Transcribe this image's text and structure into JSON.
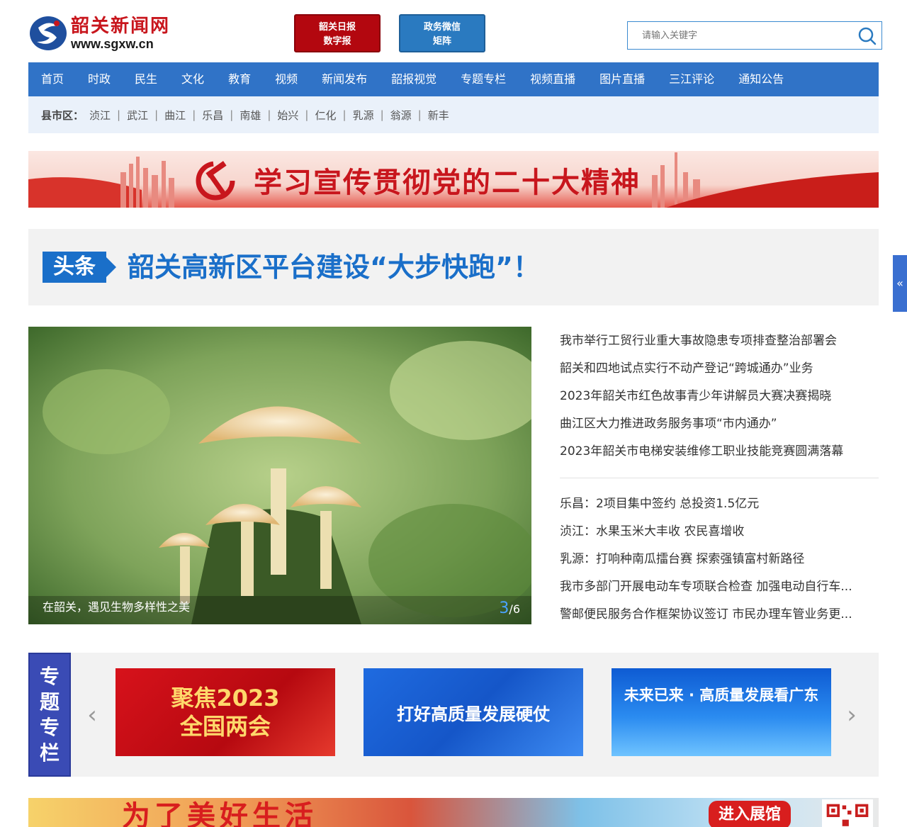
{
  "header": {
    "logo_cn": "韶关新闻网",
    "logo_url": "www.sgxw.cn",
    "btn_daily_line1": "韶关日报",
    "btn_daily_line2": "数字报",
    "btn_gov_line1": "政务微信",
    "btn_gov_line2": "矩阵",
    "search_placeholder": "请输入关键字"
  },
  "nav": [
    "首页",
    "时政",
    "民生",
    "文化",
    "教育",
    "视频",
    "新闻发布",
    "韶报视觉",
    "专题专栏",
    "视频直播",
    "图片直播",
    "三江评论",
    "通知公告"
  ],
  "county": {
    "label": "县市区：",
    "items": [
      "浈江",
      "武江",
      "曲江",
      "乐昌",
      "南雄",
      "始兴",
      "仁化",
      "乳源",
      "翁源",
      "新丰"
    ],
    "separator": "|"
  },
  "banner": {
    "text": "学习宣传贯彻党的二十大精神"
  },
  "headline": {
    "badge": "头条",
    "title": "韶关高新区平台建设“大步快跑”！"
  },
  "slideshow": {
    "caption": "在韶关，遇见生物多样性之美",
    "current": "3",
    "total": "/6"
  },
  "news_top": [
    "我市举行工贸行业重大事故隐患专项排查整治部署会",
    "韶关和四地试点实行不动产登记“跨城通办”业务",
    "2023年韶关市红色故事青少年讲解员大赛决赛揭晓",
    "曲江区大力推进政务服务事项“市内通办”",
    "2023年韶关市电梯安装维修工职业技能竞赛圆满落幕"
  ],
  "news_bottom": [
    "乐昌：2项目集中签约 总投资1.5亿元",
    "浈江：水果玉米大丰收 农民喜增收",
    "乳源：打响种南瓜擂台赛 探索强镇富村新路径",
    "我市多部门开展电动车专项联合检查 加强电动自行车...",
    "警邮便民服务合作框架协议签订 市民办理车管业务更..."
  ],
  "topics": {
    "label_chars": [
      "专",
      "题",
      "专",
      "栏"
    ],
    "prev": "‹",
    "next": "›",
    "cards": [
      {
        "line1": "聚焦2023",
        "line2": "全国两会"
      },
      {
        "text": "打好高质量发展硬仗"
      },
      {
        "text": "未来已来 · 高质量发展看广东"
      }
    ]
  },
  "bottom_banner": {
    "text": "为了美好生活",
    "sub": "进入展馆"
  },
  "sidetab": {
    "label": "«"
  },
  "colors": {
    "nav_blue": "#3073c7",
    "brand_red": "#c8161d",
    "headline_blue": "#1a6fc9",
    "topics_label": "#3a4bb5"
  }
}
